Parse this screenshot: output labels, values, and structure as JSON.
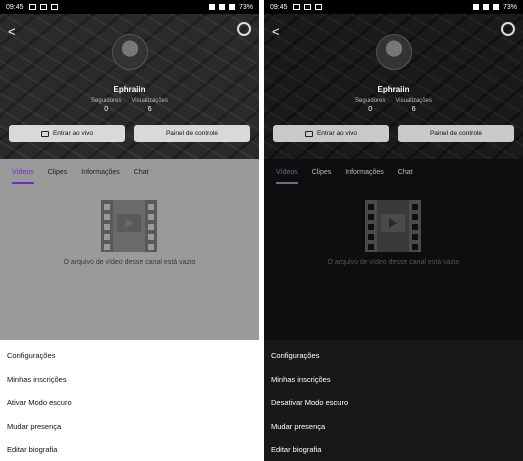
{
  "panels": [
    {
      "status": {
        "time": "09:45",
        "battery": "73%"
      },
      "profile": {
        "name": "Ephraiin",
        "followers_label": "Seguidores",
        "followers_value": "0",
        "views_label": "Visualizações",
        "views_value": "6"
      },
      "buttons": {
        "live": "Entrar ao vivo",
        "dashboard": "Painel de controle"
      },
      "tabs": [
        "Vídeos",
        "Clipes",
        "Informações",
        "Chat"
      ],
      "empty_message": "O arquivo de vídeo desse canal está vazio",
      "menu": [
        "Configurações",
        "Minhas inscrições",
        "Ativar Modo escuro",
        "Mudar presença",
        "Editar biografia"
      ]
    },
    {
      "status": {
        "time": "09:45",
        "battery": "73%"
      },
      "profile": {
        "name": "Ephraiin",
        "followers_label": "Seguidores",
        "followers_value": "0",
        "views_label": "Visualizações",
        "views_value": "6"
      },
      "buttons": {
        "live": "Entrar ao vivo",
        "dashboard": "Painel de controle"
      },
      "tabs": [
        "Vídeos",
        "Clipes",
        "Informações",
        "Chat"
      ],
      "empty_message": "O arquivo de vídeo desse canal está vazio",
      "menu": [
        "Configurações",
        "Minhas inscrições",
        "Desativar Modo escuro",
        "Mudar presença",
        "Editar biografia"
      ]
    }
  ],
  "colors": {
    "accent_light": "#6a32c8",
    "accent_dark": "#6f6f78"
  }
}
